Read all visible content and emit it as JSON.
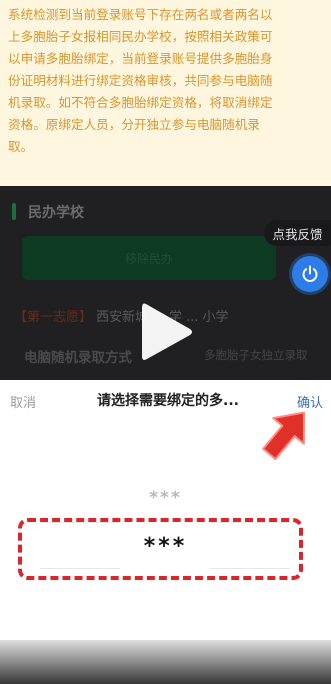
{
  "notice": {
    "lines": [
      "系统检测到当前登录账号下存在两名或者两名以",
      "上多胞胎子女报相同民办学校，按照相关政策可",
      "以申请多胞胎绑定，当前登录账号提供多胞胎身",
      "份证明材料进行绑定资格审核，共同参与电脑随",
      "机录取。如不符合多胞胎绑定资格，将取消绑定",
      "资格。原绑定人员，分开独立参与电脑随机录",
      "取。"
    ]
  },
  "background_page": {
    "section_title": "民办学校",
    "green_button": "移除民办",
    "step_tag": "【第一志愿】",
    "step_text": "西安新城 ... 学 ... 小学",
    "method_title": "电脑随机录取方式",
    "method_value": "多胞胎子女独立录取"
  },
  "feedback": {
    "label": "点我反馈"
  },
  "sheet": {
    "cancel": "取消",
    "title": "请选择需要绑定的多...",
    "confirm": "确认",
    "picker_above": "***",
    "picker_selected": "***"
  },
  "colors": {
    "notice_bg": "#fff6df",
    "notice_text": "#d8962f",
    "confirm": "#3d6fb3",
    "highlight": "#d8262a",
    "feedback_button": "#2d7de8"
  }
}
